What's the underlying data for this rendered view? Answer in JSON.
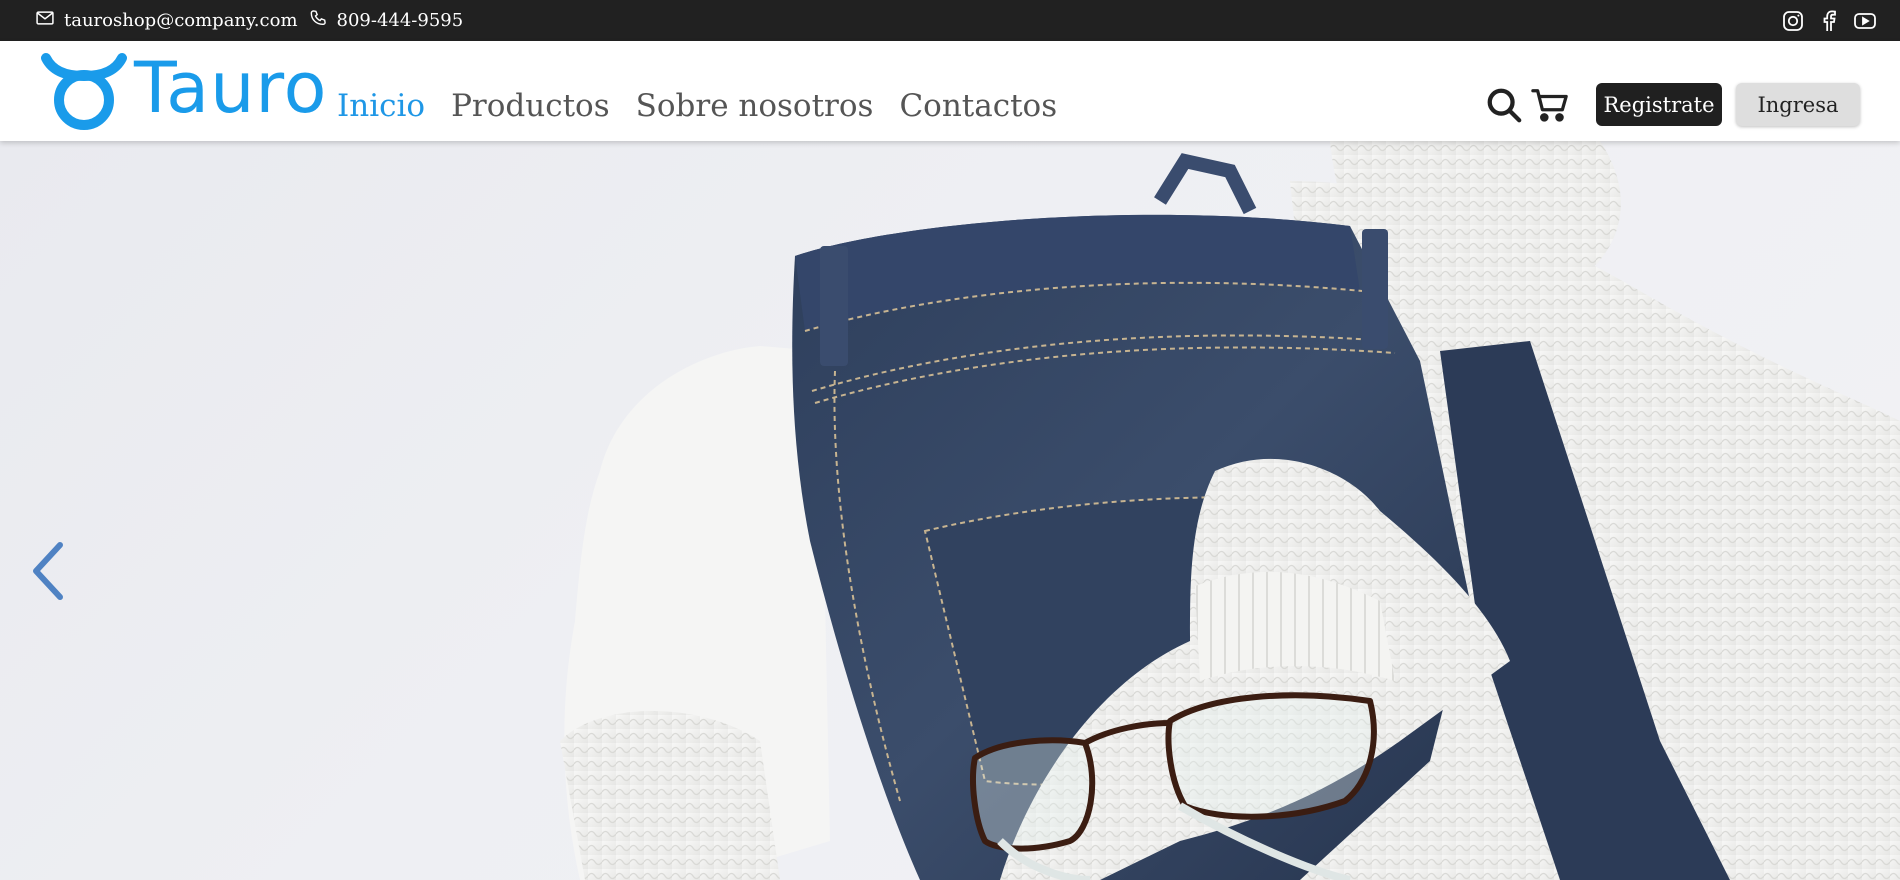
{
  "topbar": {
    "email": "tauroshop@company.com",
    "phone": "809-444-9595",
    "social": [
      {
        "icon": "instagram-icon"
      },
      {
        "icon": "facebook-icon"
      },
      {
        "icon": "youtube-icon"
      }
    ]
  },
  "header": {
    "logo_text": "Tauro",
    "nav": [
      {
        "label": "Inicio",
        "active": true
      },
      {
        "label": "Productos",
        "active": false
      },
      {
        "label": "Sobre nosotros",
        "active": false
      },
      {
        "label": "Contactos",
        "active": false
      }
    ],
    "register_label": "Registrate",
    "login_label": "Ingresa"
  },
  "hero": {
    "prev_icon": "chevron-left-icon"
  },
  "colors": {
    "brand": "#1a9bea",
    "nav_active": "#1f97e6",
    "topbar_bg": "#212121",
    "dark_button": "#202020",
    "light_button": "#dedede"
  }
}
